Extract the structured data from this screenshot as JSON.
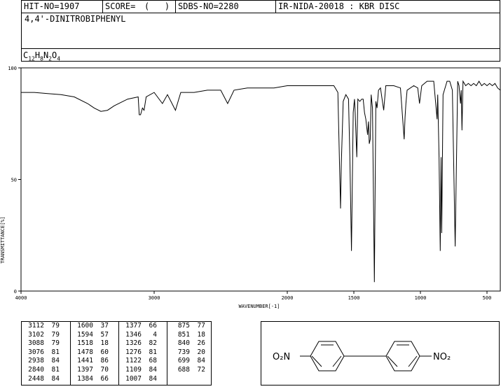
{
  "header": {
    "hit_no": "HIT-NO=1907",
    "score_label": "SCORE=",
    "score_value": "(   )",
    "sdbs_no": "SDBS-NO=2280",
    "ir_info": "IR-NIDA-20018 : KBR DISC",
    "compound": "4,4'-DINITROBIPHENYL",
    "formula_parts": [
      "C",
      "12",
      "H",
      "8",
      "N",
      "2",
      "O",
      "4"
    ]
  },
  "chart_data": {
    "type": "line",
    "xlabel": "WAVENUMBER[-1]",
    "ylabel": "TRANSMITTANCE[%]",
    "xlim": [
      4000,
      400
    ],
    "ylim": [
      0,
      100
    ],
    "x_ticks": [
      4000,
      3000,
      2000,
      1500,
      1000,
      500
    ],
    "y_ticks": [
      0,
      50,
      100
    ],
    "grid": false,
    "series": [
      {
        "x": [
          4000,
          3900,
          3800,
          3700,
          3600,
          3500,
          3450,
          3400,
          3350,
          3300,
          3200,
          3120,
          3112,
          3102,
          3088,
          3076,
          3060,
          3000,
          2938,
          2900,
          2840,
          2800,
          2700,
          2600,
          2500,
          2448,
          2400,
          2300,
          2200,
          2100,
          2000,
          1900,
          1800,
          1700,
          1650,
          1620,
          1600,
          1594,
          1580,
          1560,
          1540,
          1530,
          1518,
          1505,
          1495,
          1490,
          1478,
          1470,
          1455,
          1441,
          1430,
          1420,
          1410,
          1397,
          1390,
          1384,
          1377,
          1370,
          1360,
          1346,
          1335,
          1326,
          1315,
          1300,
          1276,
          1260,
          1200,
          1150,
          1122,
          1115,
          1109,
          1100,
          1050,
          1020,
          1007,
          990,
          950,
          920,
          900,
          875,
          870,
          860,
          851,
          845,
          840,
          830,
          800,
          780,
          760,
          739,
          720,
          710,
          699,
          693,
          688,
          680,
          660,
          640,
          620,
          600,
          580,
          560,
          540,
          520,
          500,
          480,
          460,
          440,
          420,
          400
        ],
        "y": [
          89,
          89,
          88.5,
          88,
          87,
          84,
          82,
          80.5,
          81,
          83,
          86,
          87,
          79,
          79,
          82,
          81,
          87,
          89,
          84,
          88,
          81,
          89,
          89,
          90,
          90,
          84,
          90,
          91,
          91,
          91,
          92,
          92,
          92,
          92,
          92,
          89,
          37,
          57,
          85,
          88,
          86,
          60,
          18,
          80,
          86,
          80,
          60,
          86,
          85,
          86,
          86,
          80,
          77,
          70,
          76,
          66,
          68,
          88,
          82,
          4,
          85,
          82,
          90,
          91,
          81,
          92,
          92,
          91,
          68,
          78,
          84,
          90,
          92,
          91,
          84,
          92,
          94,
          94,
          94,
          77,
          88,
          60,
          18,
          60,
          26,
          88,
          94,
          94,
          90,
          20,
          94,
          92,
          84,
          90,
          72,
          94,
          92,
          93,
          92,
          93,
          92,
          94,
          92,
          93,
          92,
          93,
          92,
          93,
          91,
          90
        ]
      }
    ]
  },
  "peaks": [
    [
      "3112",
      "79"
    ],
    [
      "3102",
      "79"
    ],
    [
      "3088",
      "79"
    ],
    [
      "3076",
      "81"
    ],
    [
      "2938",
      "84"
    ],
    [
      "2840",
      "81"
    ],
    [
      "2448",
      "84"
    ],
    [
      "1600",
      "37"
    ],
    [
      "1594",
      "57"
    ],
    [
      "1518",
      "18"
    ],
    [
      "1478",
      "60"
    ],
    [
      "1441",
      "86"
    ],
    [
      "1397",
      "70"
    ],
    [
      "1384",
      "66"
    ],
    [
      "1377",
      "66"
    ],
    [
      "1346",
      "4"
    ],
    [
      "1326",
      "82"
    ],
    [
      "1276",
      "81"
    ],
    [
      "1122",
      "68"
    ],
    [
      "1109",
      "84"
    ],
    [
      "1007",
      "84"
    ],
    [
      "875",
      "77"
    ],
    [
      "851",
      "18"
    ],
    [
      "840",
      "26"
    ],
    [
      "739",
      "20"
    ],
    [
      "699",
      "84"
    ],
    [
      "688",
      "72"
    ]
  ],
  "structure": {
    "left_group": "O₂N",
    "right_group": "NO₂"
  }
}
